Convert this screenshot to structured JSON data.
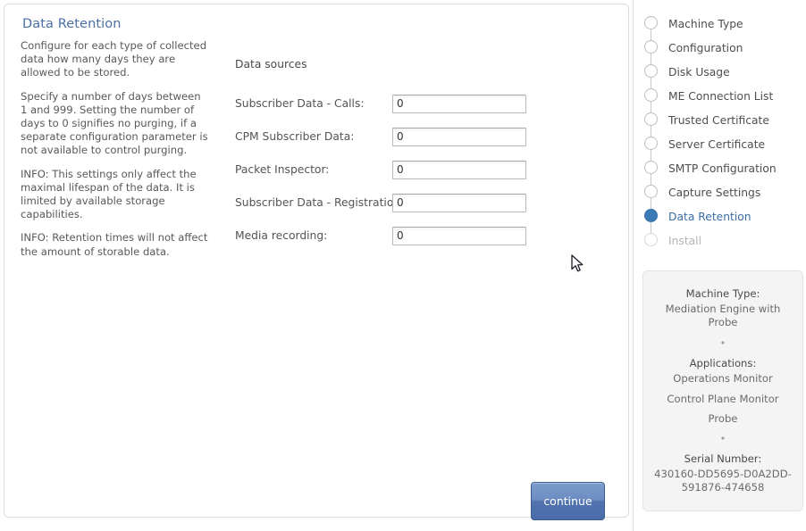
{
  "help": {
    "title": "Data Retention",
    "paragraphs": [
      "Configure for each type of collected data how many days they are allowed to be stored.",
      "Specify a number of days between 1 and 999. Setting the number of days to 0 signifies no purging, if a separate configuration parameter is not available to control purging.",
      "INFO: This settings only affect the maximal lifespan of the data. It is limited by available storage capabilities.",
      "INFO: Retention times will not affect the amount of storable data."
    ]
  },
  "form": {
    "heading": "Data sources",
    "fields": [
      {
        "label": "Subscriber Data - Calls:",
        "value": "0"
      },
      {
        "label": "CPM Subscriber Data:",
        "value": "0"
      },
      {
        "label": "Packet Inspector:",
        "value": "0"
      },
      {
        "label": "Subscriber Data - Registrations:",
        "value": "0"
      },
      {
        "label": "Media recording:",
        "value": "0"
      }
    ],
    "continue_label": "continue"
  },
  "steps": [
    {
      "label": "Machine Type",
      "state": "pending"
    },
    {
      "label": "Configuration",
      "state": "pending"
    },
    {
      "label": "Disk Usage",
      "state": "pending"
    },
    {
      "label": "ME Connection List",
      "state": "pending"
    },
    {
      "label": "Trusted Certificate",
      "state": "pending"
    },
    {
      "label": "Server Certificate",
      "state": "pending"
    },
    {
      "label": "SMTP Configuration",
      "state": "pending"
    },
    {
      "label": "Capture Settings",
      "state": "pending"
    },
    {
      "label": "Data Retention",
      "state": "active"
    },
    {
      "label": "Install",
      "state": "disabled"
    }
  ],
  "summary": {
    "machine_type_label": "Machine Type:",
    "machine_type_value": "Mediation Engine with Probe",
    "separator": "•",
    "applications_label": "Applications:",
    "applications": [
      "Operations Monitor",
      "Control Plane Monitor",
      "Probe"
    ],
    "serial_label": "Serial Number:",
    "serial_value": "430160-DD5695-D0A2DD-591876-474658"
  },
  "colors": {
    "accent": "#4a6fa5",
    "active_step": "#3a7bb5",
    "button": "#5273ae"
  }
}
